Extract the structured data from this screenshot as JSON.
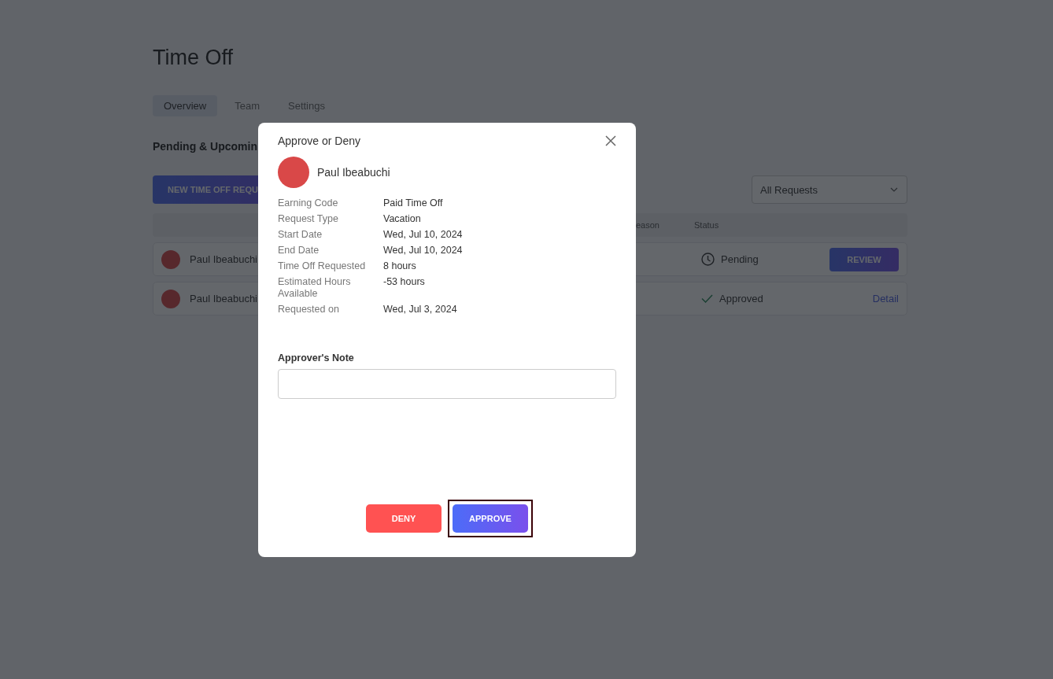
{
  "page": {
    "title": "Time Off"
  },
  "tabs": [
    {
      "label": "Overview",
      "selected": true
    },
    {
      "label": "Team",
      "selected": false
    },
    {
      "label": "Settings",
      "selected": false
    }
  ],
  "section_title": "Pending & Upcomin",
  "new_request_button": "NEW TIME OFF REQU",
  "filter": {
    "value": "All Requests"
  },
  "table": {
    "columns": [
      "eason",
      "Status"
    ],
    "rows": [
      {
        "name": "Paul Ibeabuchi",
        "status": {
          "text": "Pending",
          "kind": "pending"
        },
        "action": {
          "label": "REVIEW",
          "kind": "button"
        }
      },
      {
        "name": "Paul Ibeabuchi",
        "status": {
          "text": "Approved",
          "kind": "approved"
        },
        "action": {
          "label": "Detail",
          "kind": "link"
        }
      }
    ]
  },
  "dialog": {
    "title": "Approve or Deny",
    "employee": "Paul Ibeabuchi",
    "details": [
      {
        "label": "Earning Code",
        "value": "Paid Time Off"
      },
      {
        "label": "Request Type",
        "value": "Vacation"
      },
      {
        "label": "Start Date",
        "value": "Wed, Jul 10, 2024"
      },
      {
        "label": "End Date",
        "value": "Wed, Jul 10, 2024"
      },
      {
        "label": "Time Off Requested",
        "value": "8 hours"
      },
      {
        "label": "Estimated Hours Available",
        "value": "-53 hours"
      },
      {
        "label": "Requested on",
        "value": "Wed, Jul 3, 2024"
      }
    ],
    "note_label": "Approver's Note",
    "buttons": [
      {
        "label": "DENY",
        "kind": "deny",
        "highlighted": false
      },
      {
        "label": "APPROVE",
        "kind": "approve",
        "highlighted": true
      }
    ]
  }
}
